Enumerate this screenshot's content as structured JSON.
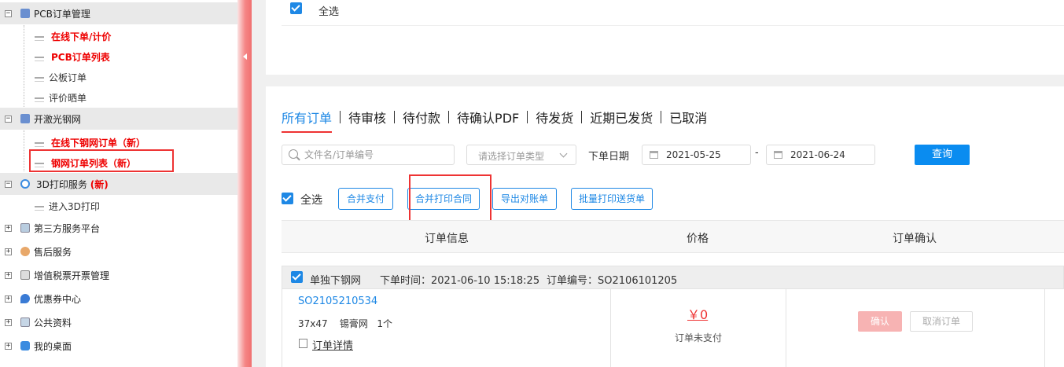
{
  "sidebar": {
    "pcb_group": {
      "label": "PCB订单管理"
    },
    "pcb_items": [
      "在线下单/计价",
      "PCB订单列表",
      "公板订单",
      "评价晒单"
    ],
    "stencil_group": {
      "label": "开激光钢网"
    },
    "stencil_items": {
      "online_order": "在线下钢网订单（新）",
      "order_list": "钢网订单列表（新）"
    },
    "print3d_group": {
      "label": "3D打印服务",
      "badge": "(新)"
    },
    "print3d_items": [
      "进入3D打印"
    ],
    "collapsed_groups": [
      "第三方服务平台",
      "售后服务",
      "增值税票开票管理",
      "优惠券中心",
      "公共资料",
      "我的桌面"
    ]
  },
  "top_panel": {
    "select_all": "全选"
  },
  "tabs": [
    "所有订单",
    "待审核",
    "待付款",
    "待确认PDF",
    "待发货",
    "近期已发货",
    "已取消"
  ],
  "filters": {
    "search_placeholder": "文件名/订单编号",
    "order_type_placeholder": "请选择订单类型",
    "date_label": "下单日期",
    "date_from": "2021-05-25",
    "date_separator": "-",
    "date_to": "2021-06-24",
    "query_button": "查询"
  },
  "actions": {
    "select_all": "全选",
    "merge_pay": "合并支付",
    "merge_print_contract": "合并打印合同",
    "export_statement": "导出对账单",
    "batch_print_delivery": "批量打印送货单"
  },
  "table": {
    "headers": [
      "订单信息",
      "价格",
      "订单确认"
    ]
  },
  "order": {
    "type": "单独下钢网",
    "time_label": "下单时间：",
    "time": "2021-06-10 15:18:25",
    "number_label": "订单编号：",
    "number": "SO2106101205",
    "sub_number": "SO2105210534",
    "size": "37x47",
    "material": "锡膏网",
    "qty": "1个",
    "detail_link": "订单详情",
    "price": "￥0",
    "pay_status": "订单未支付",
    "confirm_button": "确认",
    "cancel_button": "取消订单"
  },
  "colors": {
    "accent": "#1e88e5",
    "highlight": "#e33333",
    "splitter": "#f07070"
  }
}
